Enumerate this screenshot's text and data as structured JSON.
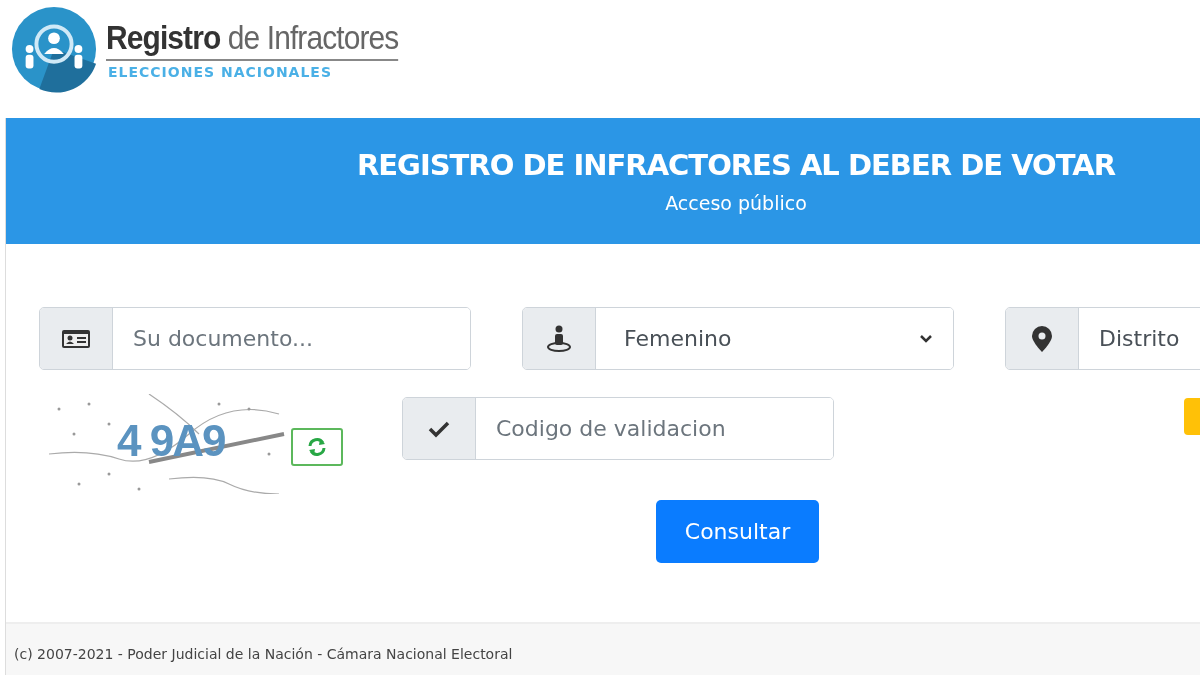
{
  "logo": {
    "title_bold": "Registro",
    "title_rest": "de Infractores",
    "subtitle": "ELECCIONES NACIONALES"
  },
  "header": {
    "title": "REGISTRO DE INFRACTORES AL DEBER DE VOTAR",
    "subtitle": "Acceso público"
  },
  "fields": [
    {
      "kind": "document",
      "placeholder": "Su documento..."
    },
    {
      "kind": "select",
      "value": "Femenino"
    },
    {
      "kind": "district",
      "value": "Distrito"
    }
  ],
  "captcha": {
    "text": "4 9A9"
  },
  "validation": {
    "placeholder": "Codigo de validacion"
  },
  "submit": "Consultar",
  "footer": "(c) 2007-2021 - Poder Judicial de la Nación - Cámara Nacional Electoral"
}
